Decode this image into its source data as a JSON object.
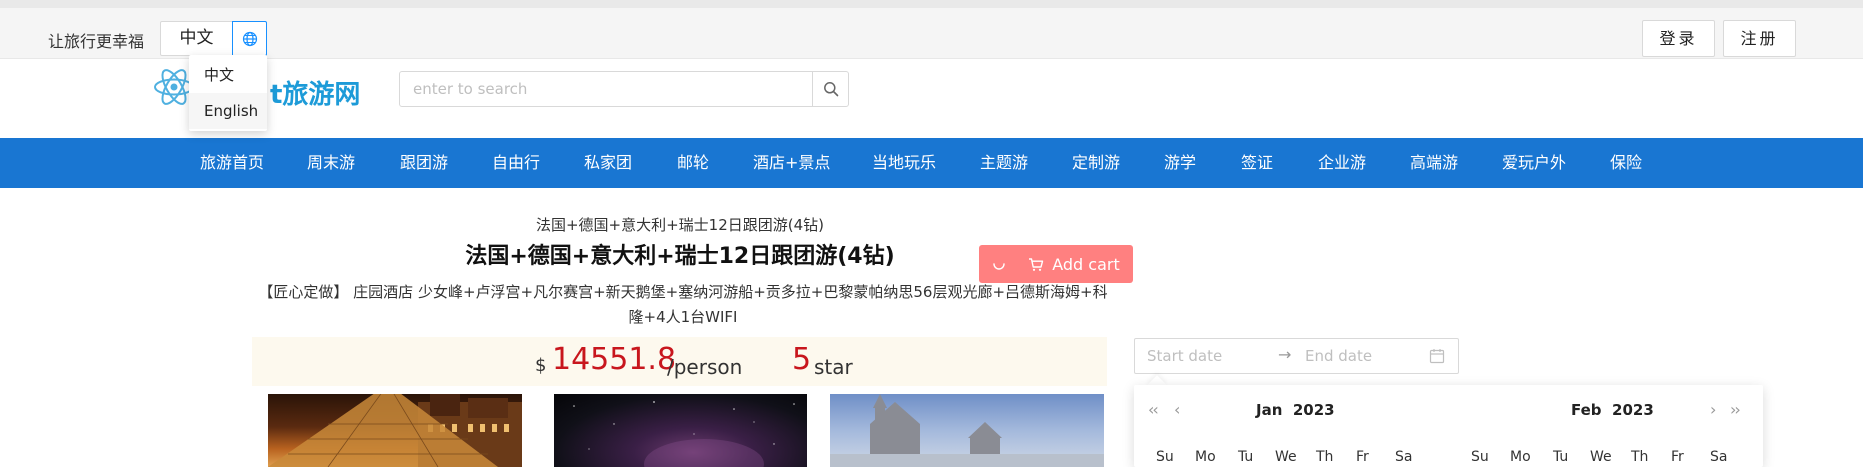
{
  "header": {
    "slogan": "让旅行更幸福",
    "language_button": "中文",
    "login": "登录",
    "register": "注册"
  },
  "language_menu": {
    "items": [
      "中文",
      "English"
    ]
  },
  "logo": {
    "text": "t旅游网"
  },
  "search": {
    "placeholder": "enter to search"
  },
  "nav": {
    "items": [
      "旅游首页",
      "周末游",
      "跟团游",
      "自由行",
      "私家团",
      "邮轮",
      "酒店+景点",
      "当地玩乐",
      "主题游",
      "定制游",
      "游学",
      "签证",
      "企业游",
      "高端游",
      "爱玩户外",
      "保险"
    ]
  },
  "product": {
    "subtitle": "法国+德国+意大利+瑞士12日跟团游(4钻)",
    "title": "法国+德国+意大利+瑞士12日跟团游(4钻)",
    "description": "【匠心定做】 庄园酒店 少女峰+卢浮宫+凡尔赛宫+新天鹅堡+塞纳河游船+贡多拉+巴黎蒙帕纳思56层观光廊+吕德斯海姆+科隆+4人1台WIFI",
    "add_cart": "Add cart",
    "currency": "$",
    "price": "14551.8",
    "per": "/person",
    "star_count": "5",
    "star_label": "star"
  },
  "date_picker": {
    "start_placeholder": "Start date",
    "end_placeholder": "End date",
    "arrow": "→",
    "left_month": "Jan",
    "left_year": "2023",
    "right_month": "Feb",
    "right_year": "2023",
    "weekdays": [
      "Su",
      "Mo",
      "Tu",
      "We",
      "Th",
      "Fr",
      "Sa"
    ]
  },
  "colors": {
    "nav_bg": "#1976d2",
    "price": "#c8161d",
    "add_cart": "#ff8080",
    "logo": "#1d9bd8",
    "accent": "#1890ff"
  },
  "icons": {
    "globe": "globe-icon",
    "search": "search-icon",
    "cart": "cart-icon",
    "calendar": "calendar-icon",
    "logo": "react-atom-logo-icon",
    "spinner": "loading-spinner-icon"
  }
}
